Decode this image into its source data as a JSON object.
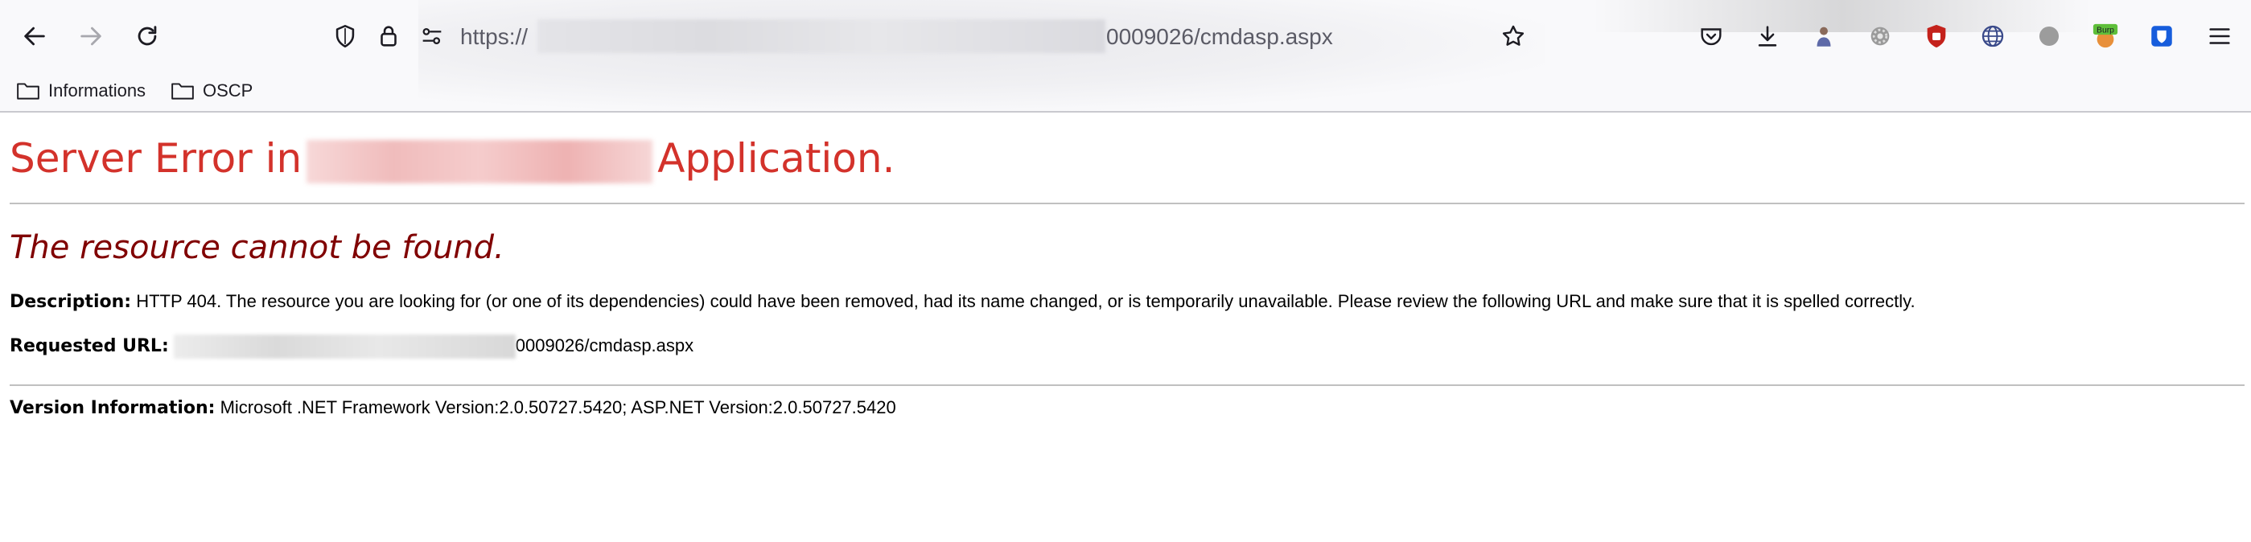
{
  "browser": {
    "url_prefix": "https://",
    "url_suffix": "0009026/cmdasp.aspx",
    "bookmarks": [
      {
        "label": "Informations"
      },
      {
        "label": "OSCP"
      }
    ],
    "extensions": [
      {
        "name": "pocket-icon"
      },
      {
        "name": "download-icon"
      },
      {
        "name": "profile-avatar-icon"
      },
      {
        "name": "settings-gear-icon"
      },
      {
        "name": "ublock-icon"
      },
      {
        "name": "globe-extension-icon"
      },
      {
        "name": "dark-reader-icon"
      },
      {
        "name": "burp-extension-icon",
        "label": "Burp"
      },
      {
        "name": "bitwarden-icon",
        "label": "B"
      },
      {
        "name": "hamburger-menu-icon"
      }
    ]
  },
  "page": {
    "title_start": "Server Error in",
    "title_end": "Application.",
    "subtitle": "The resource cannot be found.",
    "description_label": "Description:",
    "description_text": " HTTP 404. The resource you are looking for (or one of its dependencies) could have been removed, had its name changed, or is temporarily unavailable.  Please review the following URL and make sure that it is spelled correctly.",
    "requested_url_label": "Requested URL:",
    "requested_url_suffix": "0009026/cmdasp.aspx",
    "version_label": "Version Information:",
    "version_text": " Microsoft .NET Framework Version:2.0.50727.5420; ASP.NET Version:2.0.50727.5420"
  },
  "colors": {
    "title": "#d3322b",
    "subtitle": "#800000",
    "chrome_bg": "#f9f9fb"
  }
}
